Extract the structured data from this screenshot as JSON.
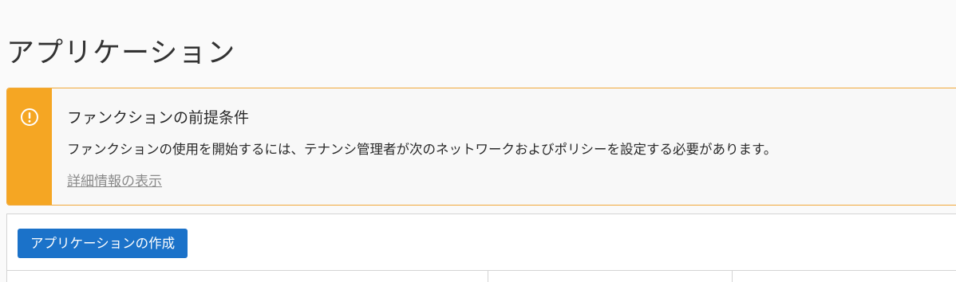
{
  "page": {
    "title": "アプリケーション"
  },
  "alert": {
    "icon": "exclamation-circle-icon",
    "title": "ファンクションの前提条件",
    "body": "ファンクションの使用を開始するには、テナンシ管理者が次のネットワークおよびポリシーを設定する必要があります。",
    "link": "詳細情報の表示",
    "accent_color": "#f5a623"
  },
  "toolbar": {
    "create_label": "アプリケーションの作成",
    "button_color": "#1b72c9"
  },
  "table": {
    "columns": [
      "",
      "",
      ""
    ]
  }
}
